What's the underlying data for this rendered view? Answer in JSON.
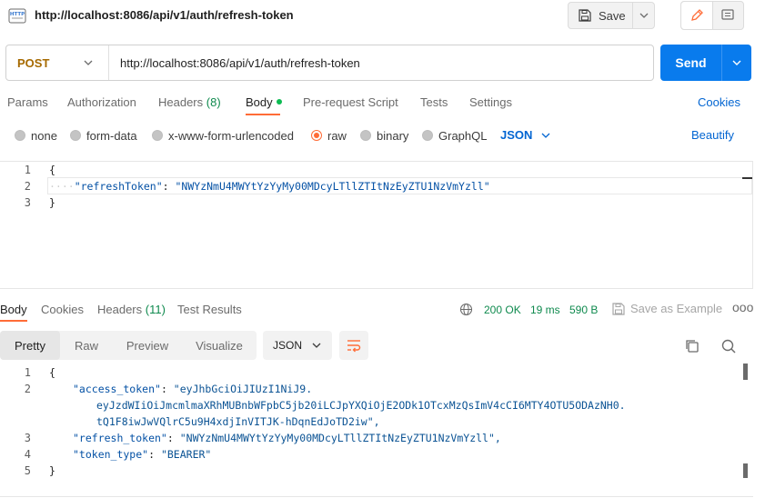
{
  "request": {
    "title": "http://localhost:8086/api/v1/auth/refresh-token",
    "method": "POST",
    "url": "http://localhost:8086/api/v1/auth/refresh-token",
    "icon_text": "HTTP"
  },
  "toolbar": {
    "save_label": "Save",
    "send_label": "Send"
  },
  "request_tabs": [
    {
      "label": "Params"
    },
    {
      "label": "Authorization"
    },
    {
      "label": "Headers",
      "count": "(8)"
    },
    {
      "label": "Body"
    },
    {
      "label": "Pre-request Script"
    },
    {
      "label": "Tests"
    },
    {
      "label": "Settings"
    }
  ],
  "cookies_label": "Cookies",
  "body_types": [
    {
      "label": "none"
    },
    {
      "label": "form-data"
    },
    {
      "label": "x-www-form-urlencoded"
    },
    {
      "label": "raw"
    },
    {
      "label": "binary"
    },
    {
      "label": "GraphQL"
    }
  ],
  "body_format": "JSON",
  "beautify_label": "Beautify",
  "request_body": {
    "line_numbers": [
      "1",
      "2",
      "3"
    ],
    "open_brace": "{",
    "close_brace": "}",
    "indent_dots": "····",
    "key": "\"refreshToken\"",
    "colon": ": ",
    "value": "\"NWYzNmU4MWYtYzYyMy00MDcyLTllZTItNzEyZTU1NzVmYzll\""
  },
  "response_tabs": [
    {
      "label": "Body"
    },
    {
      "label": "Cookies"
    },
    {
      "label": "Headers",
      "count": "(11)"
    },
    {
      "label": "Test Results"
    }
  ],
  "response_status": {
    "status": "200 OK",
    "time": "19 ms",
    "size": "590 B",
    "save_example": "Save as Example",
    "more": "ooo"
  },
  "response_views": [
    "Pretty",
    "Raw",
    "Preview",
    "Visualize"
  ],
  "response_format": "JSON",
  "response_body": {
    "line_numbers": [
      "1",
      "2",
      "3",
      "4",
      "5"
    ],
    "open_brace": "{",
    "close_brace": "}",
    "access_key": "\"access_token\"",
    "access_value_1": "\"eyJhbGciOiJIUzI1NiJ9.",
    "access_value_2": "eyJzdWIiOiJmcmlmaXRhMUBnbWFpbC5jb20iLCJpYXQiOjE2ODk1OTcxMzQsImV4cCI6MTY4OTU5ODAzNH0.",
    "access_value_3": "tQ1F8iwJwVQlrC5u9H4xdjInVITJK-hDqnEdJoTD2iw\",",
    "refresh_key": "\"refresh_token\"",
    "refresh_value": "\"NWYzNmU4MWYtYzYyMy00MDcyLTllZTItNzEyZTU1NzVmYzll\",",
    "type_key": "\"token_type\"",
    "type_value": "\"BEARER\""
  },
  "colors": {
    "accent_orange": "#ff6c37",
    "send_blue": "#097bed",
    "link_blue": "#0265d2",
    "status_green": "#0f8a4e",
    "method_color": "#a66a00"
  }
}
